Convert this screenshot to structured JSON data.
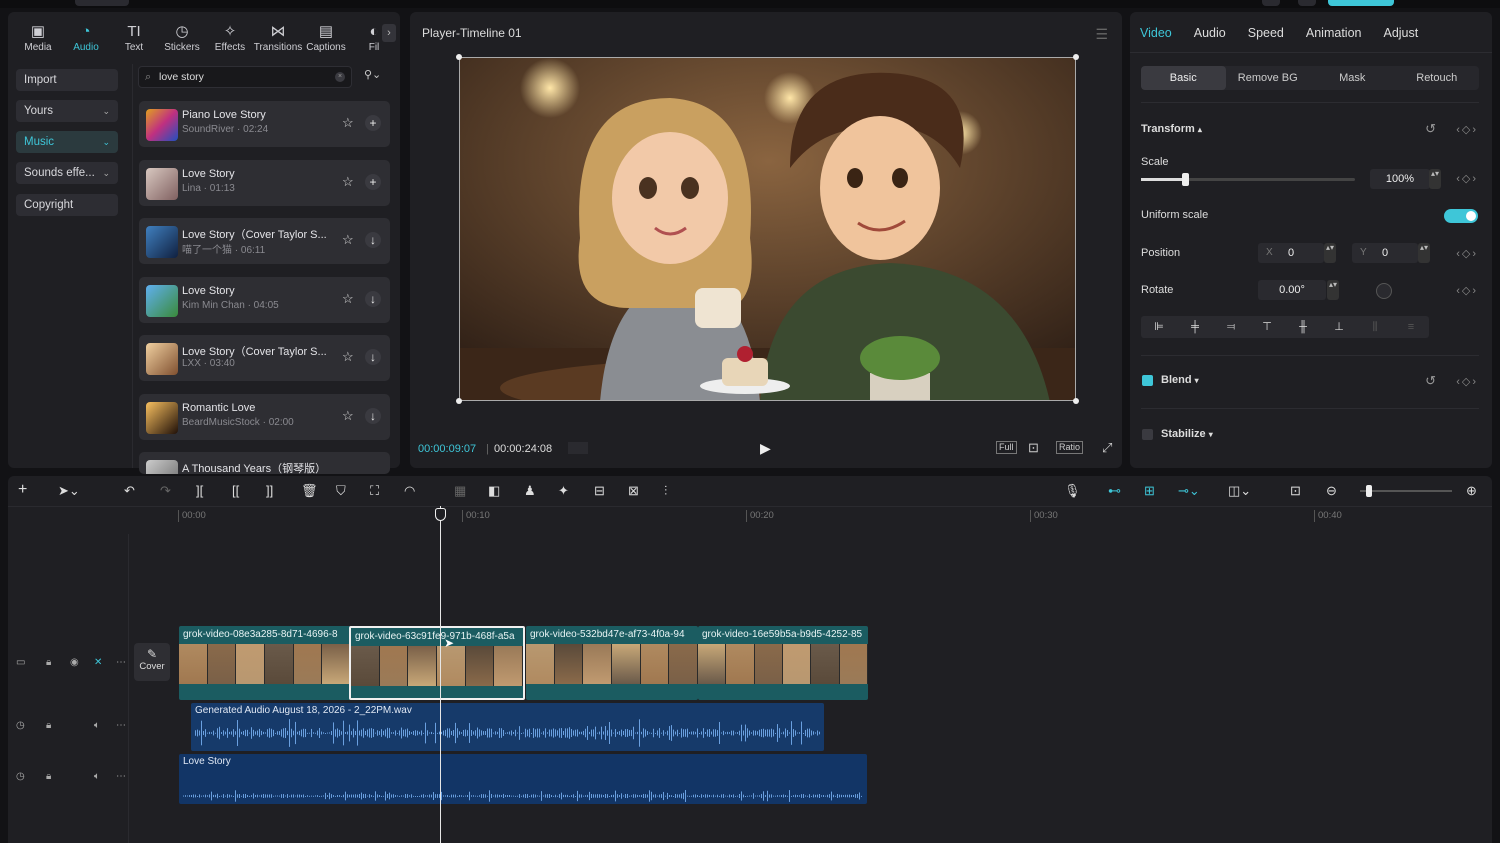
{
  "toolbar": {
    "tabs": [
      {
        "label": "Media",
        "icon": "media-icon",
        "glyph": "▣"
      },
      {
        "label": "Audio",
        "icon": "audio-icon",
        "glyph": "◔"
      },
      {
        "label": "Text",
        "icon": "text-icon",
        "glyph": "TI"
      },
      {
        "label": "Stickers",
        "icon": "stickers-icon",
        "glyph": "◷"
      },
      {
        "label": "Effects",
        "icon": "effects-icon",
        "glyph": "✧"
      },
      {
        "label": "Transitions",
        "icon": "transitions-icon",
        "glyph": "⋈"
      },
      {
        "label": "Captions",
        "icon": "captions-icon",
        "glyph": "▤"
      },
      {
        "label": "Fil",
        "icon": "filters-icon",
        "glyph": "◐"
      }
    ],
    "active_tab": "Audio",
    "more": "›"
  },
  "sidebar": {
    "items": [
      {
        "label": "Import",
        "chevron": ""
      },
      {
        "label": "Yours",
        "chevron": "⌄"
      },
      {
        "label": "Music",
        "chevron": "⌄"
      },
      {
        "label": "Sounds effe...",
        "chevron": "⌄"
      },
      {
        "label": "Copyright",
        "chevron": ""
      }
    ],
    "selected": "Music"
  },
  "search": {
    "value": "love story",
    "clear": "×",
    "filter": "⚲⌄"
  },
  "tracks": [
    {
      "title": "Piano Love Story",
      "sub": "SoundRiver · 02:24",
      "action": "+"
    },
    {
      "title": "Love Story",
      "sub": "Lina · 01:13",
      "action": "+"
    },
    {
      "title": "Love Story（Cover Taylor S...",
      "sub": "喵了一个猫 · 06:11",
      "action": "↓"
    },
    {
      "title": "Love Story",
      "sub": "Kim Min Chan · 04:05",
      "action": "↓"
    },
    {
      "title": "Love Story（Cover Taylor S...",
      "sub": "LXX · 03:40",
      "action": "↓"
    },
    {
      "title": "Romantic Love",
      "sub": "BeardMusicStock · 02:00",
      "action": "↓"
    },
    {
      "title": "A Thousand Years（钢琴版）",
      "sub": "",
      "action": ""
    }
  ],
  "player": {
    "title": "Player-Timeline 01",
    "current_time": "00:00:09:07",
    "separator": "|",
    "total_time": "00:00:24:08",
    "play": "▶",
    "full": "Full",
    "ratio": "Ratio"
  },
  "properties": {
    "tabs": [
      "Video",
      "Audio",
      "Speed",
      "Animation",
      "Adjust"
    ],
    "active_tab": "Video",
    "sub_tabs": [
      "Basic",
      "Remove BG",
      "Mask",
      "Retouch"
    ],
    "active_sub_tab": "Basic",
    "transform_label": "Transform",
    "scale_label": "Scale",
    "scale_value": "100%",
    "scale_level": 0.2,
    "uniform_scale_label": "Uniform scale",
    "uniform_scale_on": true,
    "position_label": "Position",
    "pos_x_label": "X",
    "pos_x": "0",
    "pos_y_label": "Y",
    "pos_y": "0",
    "rotate_label": "Rotate",
    "rotate_value": "0.00°",
    "blend_label": "Blend",
    "blend_checked": true,
    "stabilize_label": "Stabilize",
    "stabilize_checked": false,
    "keyframe": "‹◇›",
    "reset": "↺",
    "arrows": "▴▾"
  },
  "timeline": {
    "ruler": [
      "00:00",
      "00:10",
      "00:20",
      "00:30",
      "00:40"
    ],
    "cover_label": "Cover",
    "video_clips": [
      {
        "label": "grok-video-08e3a285-8d71-4696-8"
      },
      {
        "label": "grok-video-63c91fe9-971b-468f-a5a"
      },
      {
        "label": "grok-video-532bd47e-af73-4f0a-94"
      },
      {
        "label": "grok-video-16e59b5a-b9d5-4252-85"
      }
    ],
    "selected_clip": 1,
    "audio_clips": [
      {
        "label": "Generated Audio August 18, 2026 - 2_22PM.wav"
      },
      {
        "label": "Love Story"
      }
    ]
  },
  "colors": {
    "accent": "#3ec6d8",
    "video_clip": "#1b5c61",
    "audio_clip": "#163a6a"
  }
}
